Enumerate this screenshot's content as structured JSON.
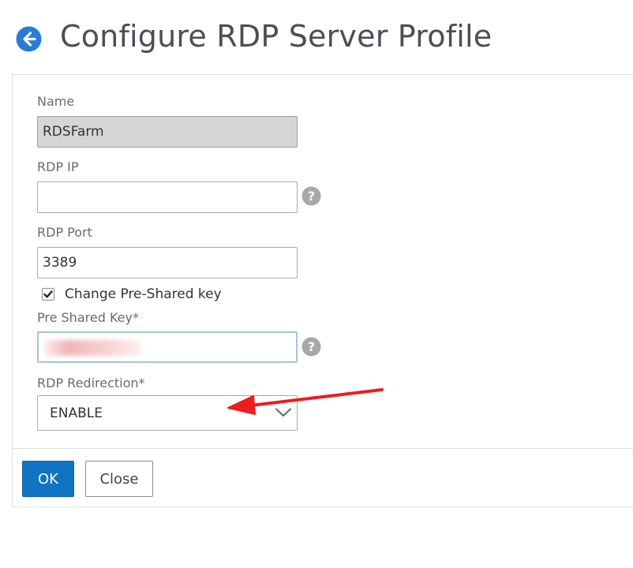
{
  "header": {
    "title": "Configure RDP Server Profile",
    "back_icon": "arrow-left-circle-icon"
  },
  "form": {
    "name": {
      "label": "Name",
      "value": "RDSFarm"
    },
    "rdp_ip": {
      "label": "RDP IP",
      "value": ""
    },
    "rdp_port": {
      "label": "RDP Port",
      "value": "3389"
    },
    "change_psk": {
      "label": "Change Pre-Shared key",
      "checked": true
    },
    "pre_shared_key": {
      "label": "Pre Shared Key*"
    },
    "rdp_redirection": {
      "label": "RDP Redirection*",
      "value": "ENABLE"
    }
  },
  "buttons": {
    "ok_label": "OK",
    "close_label": "Close"
  },
  "colors": {
    "accent": "#0f73c4",
    "annotation": "#ee1c1c",
    "help_icon": "#a8a8a8"
  }
}
